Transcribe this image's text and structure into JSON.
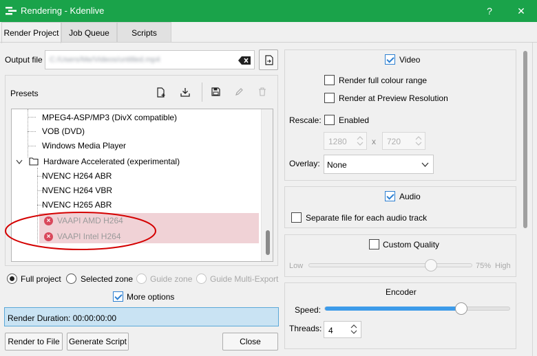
{
  "window": {
    "title": "Rendering - Kdenlive",
    "help_label": "?",
    "close_label": "✕"
  },
  "tabs": [
    {
      "label": "Render Project"
    },
    {
      "label": "Job Queue"
    },
    {
      "label": "Scripts"
    }
  ],
  "output": {
    "label": "Output file",
    "value": "C:/Users/Me/Videos/untitled.mp4"
  },
  "presets": {
    "label": "Presets",
    "items": [
      {
        "label": "MPEG4-ASP/MP3 (DivX compatible)"
      },
      {
        "label": "VOB (DVD)"
      },
      {
        "label": "Windows Media Player"
      }
    ],
    "group": {
      "label": "Hardware Accelerated (experimental)"
    },
    "hw_items": [
      {
        "label": "NVENC H264 ABR"
      },
      {
        "label": "NVENC H264 VBR"
      },
      {
        "label": "NVENC H265 ABR"
      }
    ],
    "error_items": [
      {
        "label": "VAAPI AMD H264"
      },
      {
        "label": "VAAPI Intel H264"
      }
    ]
  },
  "zone": {
    "full": "Full project",
    "selected": "Selected zone",
    "guide": "Guide zone",
    "multi": "Guide Multi-Export"
  },
  "more_options": "More options",
  "render_duration": "Render Duration: 00:00:00:00",
  "buttons": {
    "render": "Render to File",
    "script": "Generate Script",
    "close": "Close"
  },
  "video": {
    "label": "Video",
    "full_range": "Render full colour range",
    "preview_res": "Render at Preview Resolution",
    "rescale_label": "Rescale:",
    "enabled": "Enabled",
    "width": "1280",
    "x": "x",
    "height": "720",
    "overlay_label": "Overlay:",
    "overlay_value": "None"
  },
  "audio": {
    "label": "Audio",
    "separate": "Separate file for each audio track"
  },
  "quality": {
    "label": "Custom Quality",
    "low": "Low",
    "high": "High",
    "percent": "75%",
    "level": 0.75
  },
  "encoder": {
    "label": "Encoder",
    "speed_label": "Speed:",
    "speed_level": 0.74,
    "threads_label": "Threads:",
    "threads": "4"
  }
}
